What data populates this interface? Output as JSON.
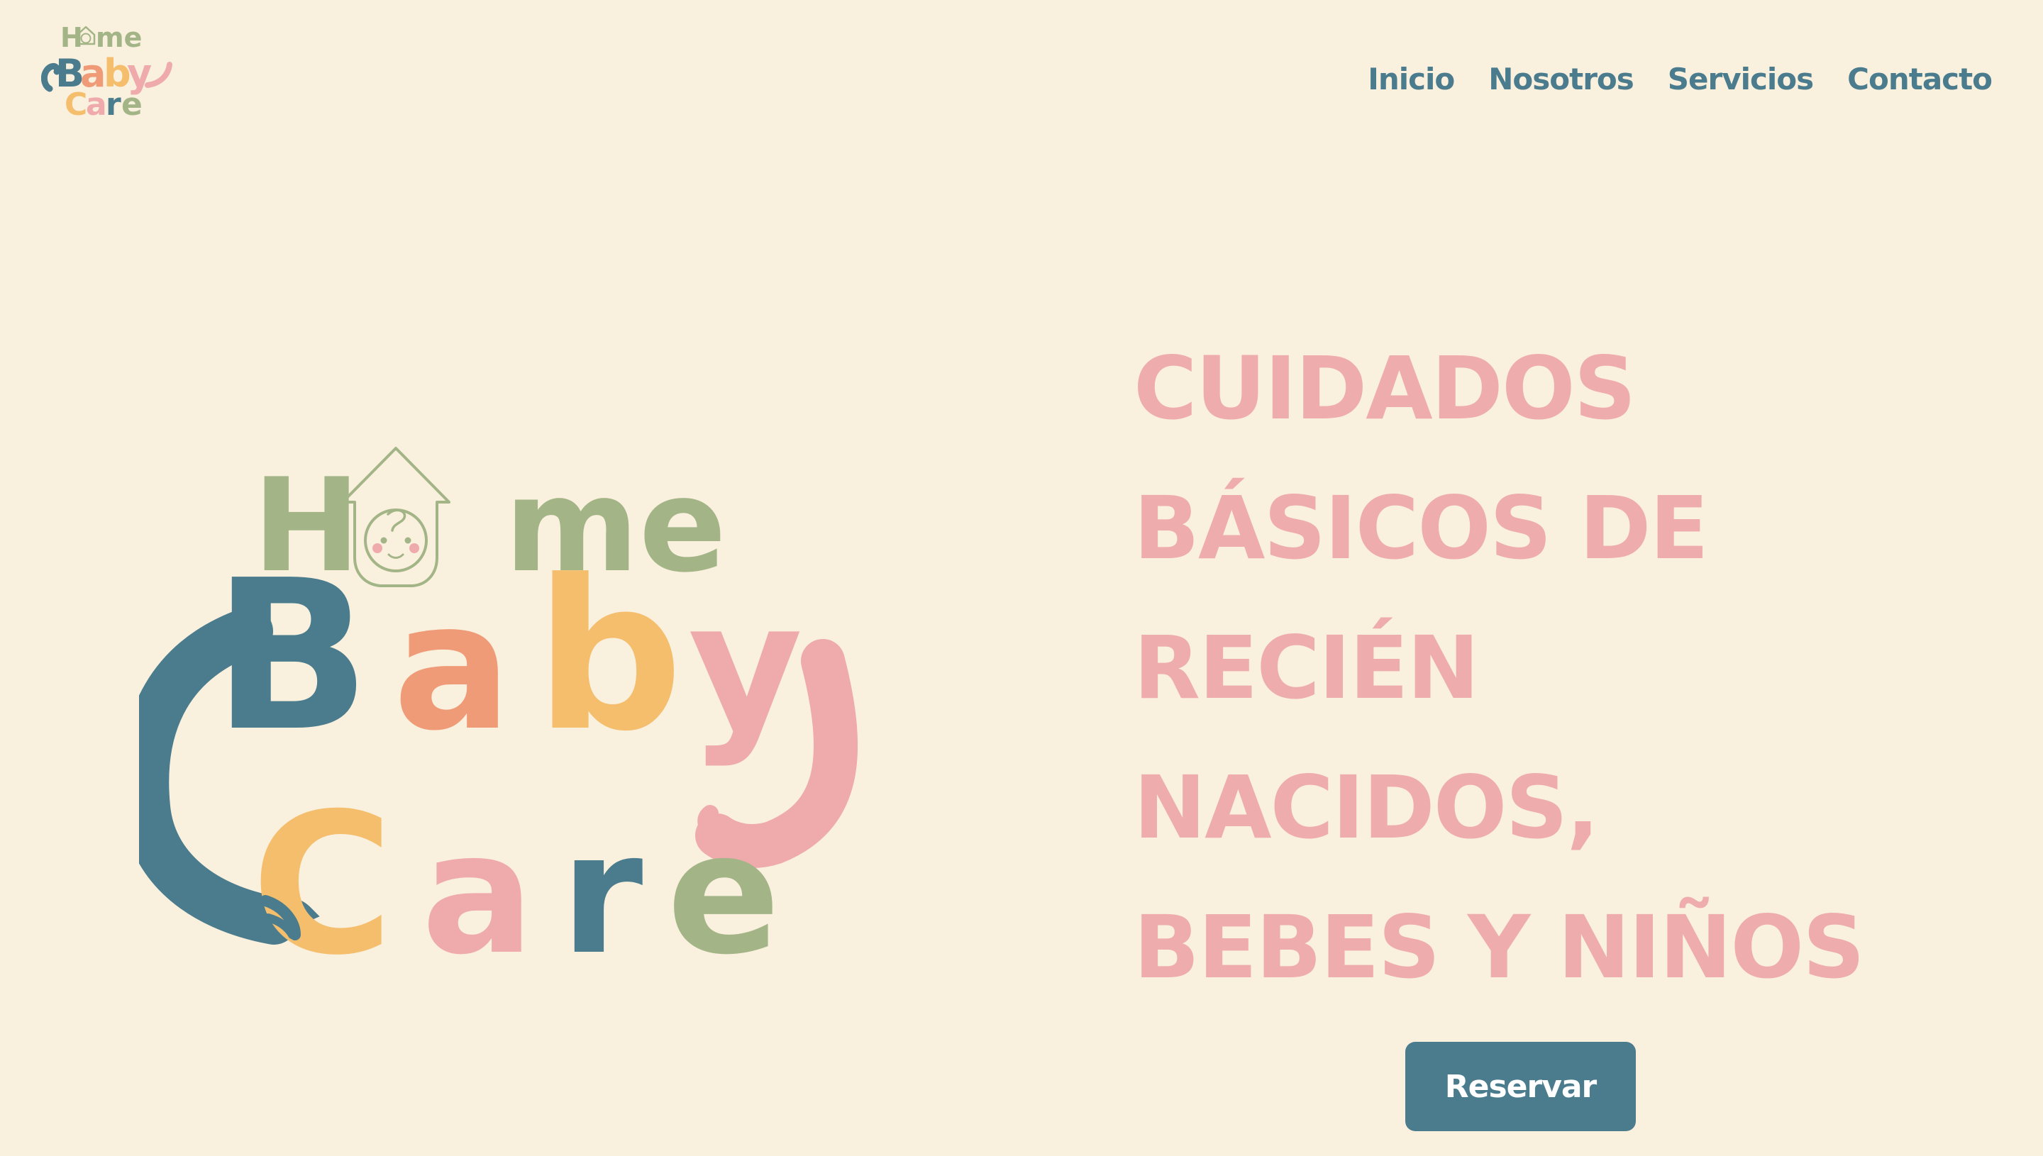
{
  "brand": {
    "name": "Home Baby Care",
    "logo_lines": {
      "home": "Home",
      "baby": "Baby",
      "care": "Care"
    }
  },
  "nav": {
    "items": [
      {
        "label": "Inicio"
      },
      {
        "label": "Nosotros"
      },
      {
        "label": "Servicios"
      },
      {
        "label": "Contacto"
      }
    ]
  },
  "hero": {
    "headline_lines": [
      "CUIDADOS",
      "BÁSICOS DE",
      "RECIÉN",
      "NACIDOS,",
      "BEBES Y NIÑOS"
    ],
    "cta_label": "Reservar"
  },
  "colors": {
    "background": "#faf0de",
    "primary_teal": "#4a7c8e",
    "headline_pink": "#efacac",
    "logo_green": "#a3b587",
    "logo_orange": "#f09b78",
    "logo_yellow": "#f4be6c",
    "logo_pink": "#efaaac",
    "button_text": "#ffffff"
  },
  "icons": {
    "house_baby": "house-baby-icon"
  }
}
